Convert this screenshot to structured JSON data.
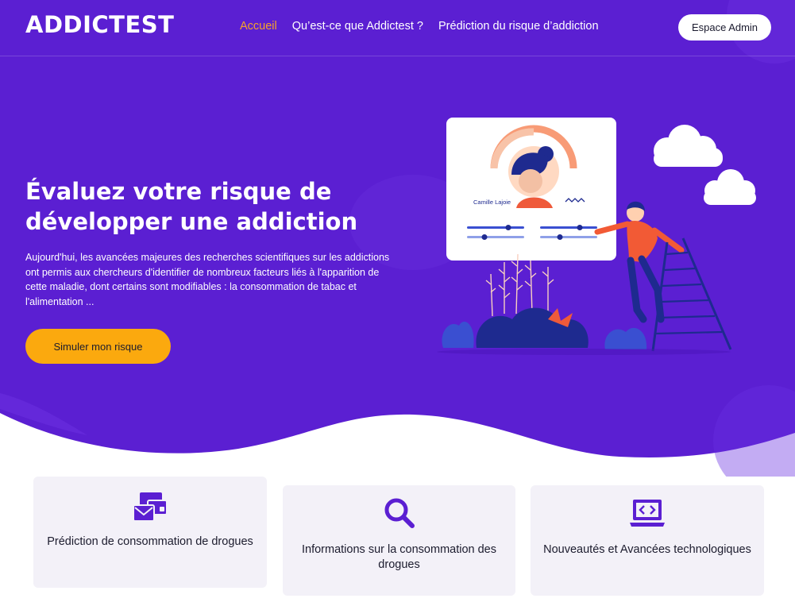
{
  "brand": {
    "logo_text": "ADDICTEST",
    "primary_color": "#5b1fd2",
    "accent_color": "#fba90e"
  },
  "nav": {
    "items": [
      {
        "label": "Accueil",
        "active": true
      },
      {
        "label": "Qu’est-ce que Addictest ?",
        "active": false
      },
      {
        "label": "Prédiction du risque d’addiction",
        "active": false
      }
    ],
    "admin_button": "Espace Admin"
  },
  "hero": {
    "title": "Évaluez votre risque de développer une addiction",
    "description": "Aujourd'hui, les avancées majeures des recherches scientifiques sur les addictions ont permis aux chercheurs d'identifier de nombreux facteurs liés à l'apparition de cette maladie, dont certains sont modifiables : la consommation de tabac et l'alimentation ...",
    "cta_button": "Simuler mon risque",
    "illustration": {
      "profile_name": "Camille Lajoie"
    }
  },
  "features": [
    {
      "icon": "mail-cards-icon",
      "title": "Prédiction de consommation de drogues"
    },
    {
      "icon": "search-icon",
      "title": "Informations sur la consommation des drogues"
    },
    {
      "icon": "laptop-code-icon",
      "title": "Nouveautés et Avancées technologiques"
    }
  ]
}
